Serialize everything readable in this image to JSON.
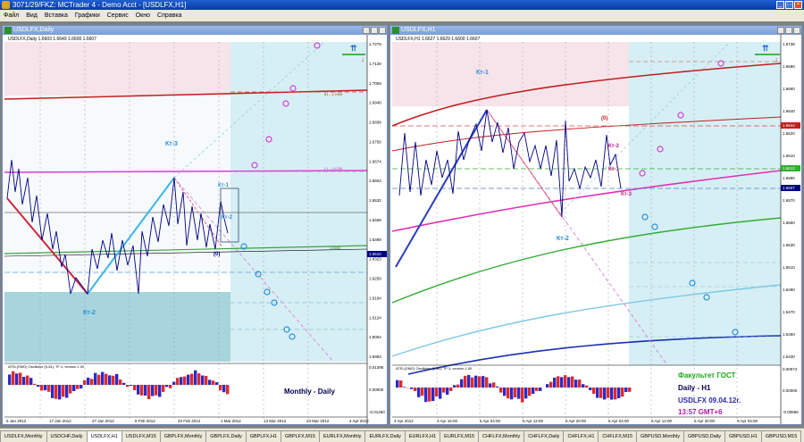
{
  "app": {
    "title": "3071/29/FKZ: MCTrader 4 - Demo Acct - [USDLFX,H1]",
    "menu": [
      "Файл",
      "Вид",
      "Вставка",
      "Графики",
      "Сервис",
      "Окно",
      "Справка"
    ]
  },
  "left_window": {
    "title": "USDLFX,Daily",
    "info": "USDLFX,Daily 1.6603 1.6649 1.6600 1.6607",
    "labels": {
      "kt3": "Кт-3",
      "kt1": "Кт-1",
      "kt2": "Кт-2",
      "kt2b": "Кт-2",
      "zero": "(0)"
    },
    "right_axis": [
      "1.7279",
      "1.7139",
      "1.7009",
      "1.6948",
      "1.6838",
      "1.6756",
      "1.6674",
      "1.6604",
      "1.6532",
      "1.6468",
      "1.6399",
      "1.6323",
      "1.6259",
      "1.6194",
      "1.6124",
      "1.6054",
      "1.5983"
    ],
    "price_box": "1.6510",
    "level_labels": [
      "61 - 1.7009",
      "L1 - 1.6756",
      "1.6454"
    ],
    "dates": [
      "5 Jan 2012",
      "17 Jan 2012",
      "27 Jan 2012",
      "8 Feb 2012",
      "20 Feb 2012",
      "1 Mar 2012",
      "13 Mar 2012",
      "23 Mar 2012",
      "4 Apr 2012"
    ],
    "osc_title": "ATEL(SMO) Oscillator (5,34); TF:1; version 1.00",
    "osc_axis": [
      "0.01395",
      "0.00000",
      "-0.01260"
    ],
    "caption": "Monthly - Daily"
  },
  "right_window": {
    "title": "USDLFX,H1",
    "info": "USDLFX,H1 1.6627 1.6629 1.6600 1.6607",
    "labels": {
      "kt1": "Кт-1",
      "kt3": "Кт-3",
      "kt2a": "Кт-2",
      "kt2b": "Кт-2",
      "kt1b": "Кт-1",
      "zero": "(0)"
    },
    "right_axis": [
      "1.6738",
      "1.6690",
      "1.6660",
      "1.6640",
      "1.6620",
      "1.6610",
      "1.6590",
      "1.6570",
      "1.6550",
      "1.6530",
      "1.6510",
      "1.6490",
      "1.6470",
      "1.6450",
      "1.6430"
    ],
    "price_boxes": [
      "1.6644",
      "1.6612",
      "1.6607"
    ],
    "dates": [
      "4 Apr 2012",
      "4 Apr 16:00",
      "5 Apr 04:00",
      "5 Apr 12:00",
      "5 Apr 20:00",
      "6 Apr 04:00",
      "6 Apr 12:00",
      "6 Apr 20:00",
      "9 Apr 04:00"
    ],
    "osc_title": "ATEL(SMO) Oscillator (5,34); TF:1; version 1.00",
    "osc_axis": [
      "0.00574",
      "0.00000",
      "-0.00556"
    ],
    "caption": {
      "faculty": "Факультет ГОСТ",
      "timeframes": "Daily - H1",
      "symbol_date": "USDLFX 09.04.12г.",
      "time": "13:57 GMT+6"
    }
  },
  "tabs": [
    "USDLFX,Monthly",
    "USDCHF,Daily",
    "USDLFX,H1",
    "USDLFX,M15",
    "GBPLFX,Monthly",
    "GBPLFX,Daily",
    "GBPLFX,H1",
    "GBPLFX,M15",
    "EURLFX,Monthly",
    "EURLFX,Daily",
    "EURLFX,H1",
    "EURLFX,M15",
    "CHFLFX,Monthly",
    "CHFLFX,Daily",
    "CHFLFX,H1",
    "CHFLFX,M15",
    "GBPUSD,Monthly",
    "GBPUSD,Daily",
    "GBPUSD,H1",
    "GBPUSD,M15"
  ],
  "active_tab": "USDLFX,H1"
}
